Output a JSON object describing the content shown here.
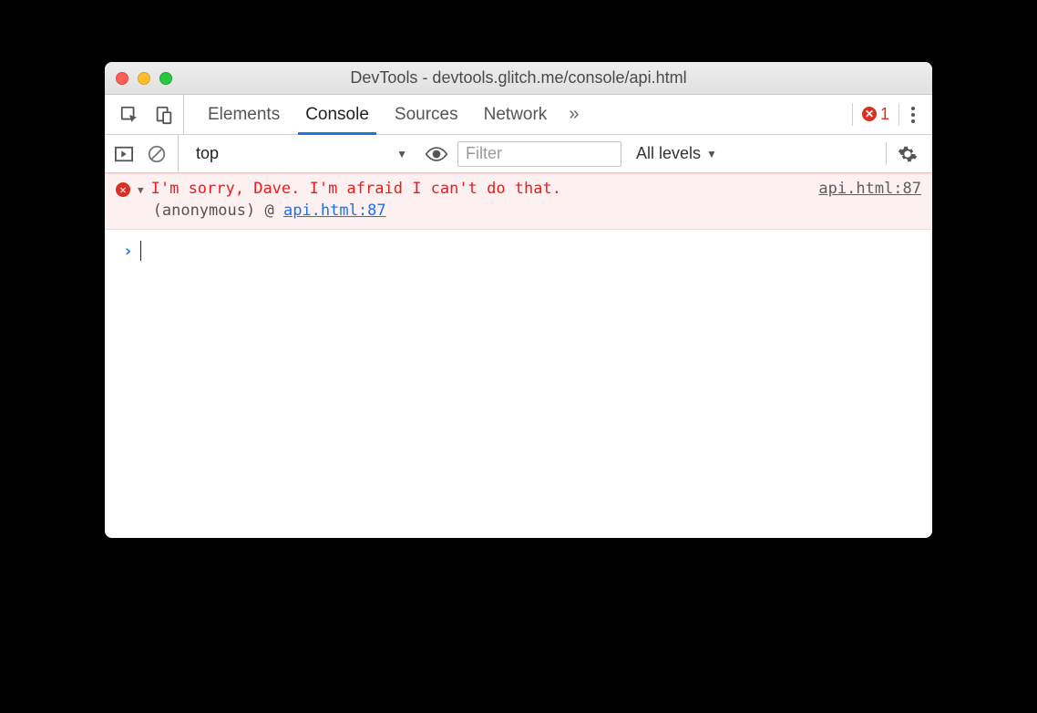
{
  "window": {
    "title": "DevTools - devtools.glitch.me/console/api.html"
  },
  "tabs": {
    "items": [
      "Elements",
      "Console",
      "Sources",
      "Network"
    ],
    "active": "Console",
    "more_glyph": "»",
    "error_count": "1"
  },
  "toolbar": {
    "context": "top",
    "filter_placeholder": "Filter",
    "levels_label": "All levels"
  },
  "console": {
    "error": {
      "message": "I'm sorry, Dave. I'm afraid I can't do that.",
      "source_link": "api.html:87",
      "trace_func": "(anonymous)",
      "trace_at": "@",
      "trace_link": "api.html:87"
    },
    "prompt": "›"
  }
}
